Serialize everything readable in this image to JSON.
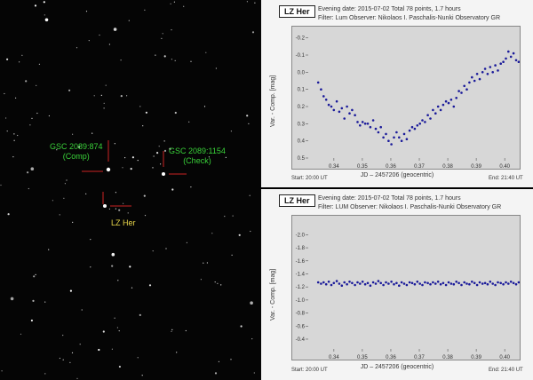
{
  "field": {
    "comp_label": "GSC 2089:874",
    "comp_sub": "(Comp)",
    "check_label": "GSC 2089:1154",
    "check_sub": "(Check)",
    "target_label": "LZ Her"
  },
  "top_panel": {
    "badge": "LZ Her",
    "line1": "Evening date: 2015-07-02     Total 78 points, 1.7 hours",
    "line2": "Filter: Lum    Observer: Nikolaos I. Paschalis-Nunki Observatory GR",
    "ylabel": "Var. - Comp. [mag]",
    "xlabel": "JD – 2457206   (geocentric)",
    "start": "Start: 20:00 UT",
    "end": "End: 21:40 UT"
  },
  "bottom_panel": {
    "badge": "LZ Her",
    "line1": "Evening date: 2015-07-02     Total 78 points, 1.7 hours",
    "line2": "Filter: LUM    Observer: Nikolaos I. Paschalis-Nunki Observatory GR",
    "ylabel": "Var. - Comp. [mag]",
    "xlabel": "JD – 2457206   (geocentric)",
    "start": "Start: 20:00 UT",
    "end": "End: 21:40 UT"
  },
  "chart_data": [
    {
      "type": "scatter",
      "title": "LZ Her",
      "xlabel": "JD – 2457206   (geocentric)",
      "ylabel": "Var. - Comp. [mag]",
      "xlim": [
        0.331,
        0.404
      ],
      "ylim": [
        -0.25,
        0.5
      ],
      "y_inverted": true,
      "xticks": [
        0.34,
        0.35,
        0.36,
        0.37,
        0.38,
        0.39,
        0.4
      ],
      "yticks": [
        -0.2,
        -0.1,
        0.0,
        0.1,
        0.2,
        0.3,
        0.4,
        0.5
      ],
      "point_color": "#1a1a9a",
      "x": [
        0.3345,
        0.3355,
        0.3364,
        0.3373,
        0.3382,
        0.3391,
        0.34,
        0.341,
        0.3419,
        0.3428,
        0.3437,
        0.3446,
        0.3455,
        0.3464,
        0.3474,
        0.3483,
        0.3492,
        0.3501,
        0.351,
        0.3519,
        0.3528,
        0.3538,
        0.3547,
        0.3556,
        0.3565,
        0.3574,
        0.3583,
        0.3592,
        0.3602,
        0.3611,
        0.362,
        0.3629,
        0.3638,
        0.3647,
        0.3656,
        0.3666,
        0.3675,
        0.3684,
        0.3693,
        0.3702,
        0.3711,
        0.372,
        0.373,
        0.3739,
        0.3748,
        0.3757,
        0.3766,
        0.3775,
        0.3784,
        0.3794,
        0.3803,
        0.3812,
        0.3821,
        0.383,
        0.3839,
        0.3848,
        0.3858,
        0.3867,
        0.3876,
        0.3885,
        0.3894,
        0.3903,
        0.3912,
        0.3922,
        0.3931,
        0.394,
        0.3949,
        0.3958,
        0.3967,
        0.3976,
        0.3986,
        0.3995,
        0.4004,
        0.4013,
        0.4022,
        0.4031,
        0.404,
        0.4049
      ],
      "y": [
        0.06,
        0.1,
        0.14,
        0.16,
        0.19,
        0.2,
        0.22,
        0.17,
        0.23,
        0.21,
        0.27,
        0.2,
        0.24,
        0.22,
        0.25,
        0.29,
        0.31,
        0.29,
        0.3,
        0.3,
        0.32,
        0.28,
        0.33,
        0.35,
        0.32,
        0.38,
        0.36,
        0.4,
        0.42,
        0.38,
        0.35,
        0.38,
        0.4,
        0.36,
        0.39,
        0.34,
        0.32,
        0.33,
        0.31,
        0.3,
        0.28,
        0.29,
        0.25,
        0.27,
        0.22,
        0.24,
        0.2,
        0.22,
        0.19,
        0.17,
        0.18,
        0.16,
        0.2,
        0.15,
        0.11,
        0.12,
        0.08,
        0.1,
        0.06,
        0.03,
        0.05,
        0.01,
        0.04,
        0.0,
        -0.02,
        0.01,
        -0.03,
        0.0,
        -0.04,
        -0.01,
        -0.05,
        -0.06,
        -0.08,
        -0.12,
        -0.09,
        -0.11,
        -0.07,
        -0.06
      ]
    },
    {
      "type": "scatter",
      "title": "LZ Her",
      "xlabel": "JD – 2457206   (geocentric)",
      "ylabel": "Var. - Comp. [mag]",
      "xlim": [
        0.331,
        0.404
      ],
      "ylim": [
        -2.25,
        -0.25
      ],
      "y_inverted": true,
      "xticks": [
        0.34,
        0.35,
        0.36,
        0.37,
        0.38,
        0.39,
        0.4
      ],
      "yticks": [
        -2.0,
        -1.8,
        -1.6,
        -1.4,
        -1.2,
        -1.0,
        -0.8,
        -0.6,
        -0.4
      ],
      "point_color": "#1a1a9a",
      "x": [
        0.3345,
        0.3355,
        0.3364,
        0.3373,
        0.3382,
        0.3391,
        0.34,
        0.341,
        0.3419,
        0.3428,
        0.3437,
        0.3446,
        0.3455,
        0.3464,
        0.3474,
        0.3483,
        0.3492,
        0.3501,
        0.351,
        0.3519,
        0.3528,
        0.3538,
        0.3547,
        0.3556,
        0.3565,
        0.3574,
        0.3583,
        0.3592,
        0.3602,
        0.3611,
        0.362,
        0.3629,
        0.3638,
        0.3647,
        0.3656,
        0.3666,
        0.3675,
        0.3684,
        0.3693,
        0.3702,
        0.3711,
        0.372,
        0.373,
        0.3739,
        0.3748,
        0.3757,
        0.3766,
        0.3775,
        0.3784,
        0.3794,
        0.3803,
        0.3812,
        0.3821,
        0.383,
        0.3839,
        0.3848,
        0.3858,
        0.3867,
        0.3876,
        0.3885,
        0.3894,
        0.3903,
        0.3912,
        0.3922,
        0.3931,
        0.394,
        0.3949,
        0.3958,
        0.3967,
        0.3976,
        0.3986,
        0.3995,
        0.4004,
        0.4013,
        0.4022,
        0.4031,
        0.404,
        0.4049
      ],
      "y": [
        -1.27,
        -1.25,
        -1.27,
        -1.24,
        -1.28,
        -1.23,
        -1.26,
        -1.29,
        -1.25,
        -1.22,
        -1.27,
        -1.24,
        -1.28,
        -1.26,
        -1.23,
        -1.27,
        -1.25,
        -1.28,
        -1.24,
        -1.26,
        -1.22,
        -1.27,
        -1.25,
        -1.29,
        -1.26,
        -1.23,
        -1.27,
        -1.25,
        -1.28,
        -1.24,
        -1.26,
        -1.22,
        -1.27,
        -1.25,
        -1.23,
        -1.27,
        -1.26,
        -1.24,
        -1.28,
        -1.25,
        -1.23,
        -1.27,
        -1.26,
        -1.24,
        -1.27,
        -1.25,
        -1.28,
        -1.24,
        -1.26,
        -1.23,
        -1.27,
        -1.25,
        -1.24,
        -1.28,
        -1.26,
        -1.23,
        -1.27,
        -1.25,
        -1.24,
        -1.28,
        -1.26,
        -1.23,
        -1.27,
        -1.25,
        -1.26,
        -1.24,
        -1.28,
        -1.25,
        -1.23,
        -1.27,
        -1.26,
        -1.24,
        -1.27,
        -1.25,
        -1.28,
        -1.26,
        -1.24,
        -1.27
      ]
    }
  ]
}
